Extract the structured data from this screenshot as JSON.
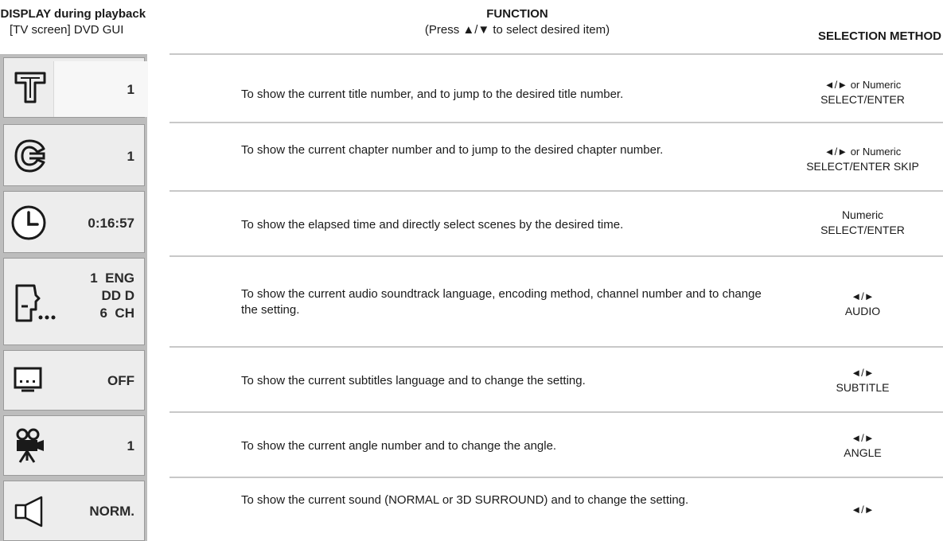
{
  "header": {
    "left_title": "s DISPLAY during playback",
    "left_sub": "[TV screen] DVD GUI",
    "function_title": "FUNCTION",
    "function_sub": "(Press ▲/▼ to select desired item)",
    "selection_title": "SELECTION METHOD"
  },
  "rows": [
    {
      "icon": "title-icon",
      "value": "1",
      "function": "To show the current title number, and to jump to the desired title number.",
      "sel_line1": "◄/► or Numeric",
      "sel_line2": "SELECT/ENTER"
    },
    {
      "icon": "chapter-icon",
      "value": "1",
      "function": "To show the current chapter number and to jump to the desired chapter number.",
      "sel_line1": "◄/► or Numeric",
      "sel_line2": "SELECT/ENTER SKIP"
    },
    {
      "icon": "clock-icon",
      "value": "0:16:57",
      "function": "To show the elapsed time and directly select scenes by the desired time.",
      "sel_line1": "Numeric",
      "sel_line2": "SELECT/ENTER"
    },
    {
      "icon": "audio-speaking-head-icon",
      "value_line1": "1  ENG",
      "value_line2": "DD D",
      "value_line3": "6  CH",
      "function": "To show the current audio soundtrack language, encoding method, channel number and to change the setting.",
      "sel_line1": "◄/►",
      "sel_line2": "AUDIO"
    },
    {
      "icon": "subtitle-icon",
      "value": "OFF",
      "function": "To show the current subtitles language and to change the setting.",
      "sel_line1": "◄/►",
      "sel_line2": "SUBTITLE"
    },
    {
      "icon": "camera-angle-icon",
      "value": "1",
      "function": "To show the current angle number and to change the angle.",
      "sel_line1": "◄/►",
      "sel_line2": "ANGLE"
    },
    {
      "icon": "speaker-icon",
      "value": "NORM.",
      "function": "To show the current sound (NORMAL or 3D SURROUND) and to change the setting.",
      "sel_line1": "◄/►",
      "sel_line2": ""
    }
  ]
}
